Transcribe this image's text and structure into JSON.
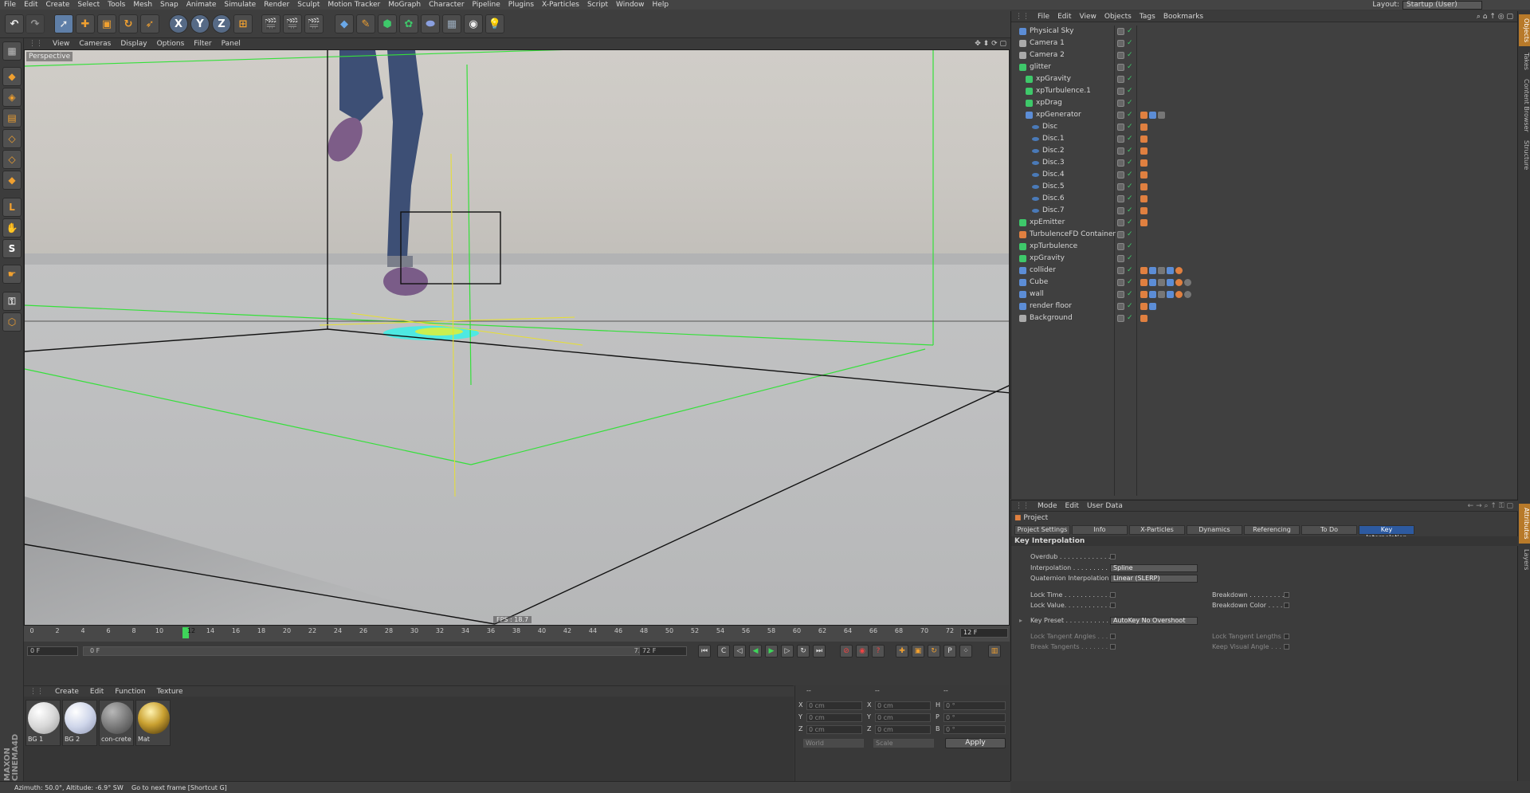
{
  "menubar": {
    "items": [
      "File",
      "Edit",
      "Create",
      "Select",
      "Tools",
      "Mesh",
      "Snap",
      "Animate",
      "Simulate",
      "Render",
      "Sculpt",
      "Motion Tracker",
      "MoGraph",
      "Character",
      "Pipeline",
      "Plugins",
      "X-Particles",
      "Script",
      "Window",
      "Help"
    ],
    "layout_label": "Layout:",
    "layout_value": "Startup (User)"
  },
  "toolbar": {
    "axis_x": "X",
    "axis_y": "Y",
    "axis_z": "Z"
  },
  "viewport": {
    "menu": [
      "View",
      "Cameras",
      "Display",
      "Options",
      "Filter",
      "Panel"
    ],
    "label": "Perspective",
    "fps": "FPS : 18.7"
  },
  "timeline": {
    "ticks": [
      "0",
      "2",
      "4",
      "6",
      "8",
      "10",
      "12",
      "14",
      "16",
      "18",
      "20",
      "22",
      "24",
      "26",
      "28",
      "30",
      "32",
      "34",
      "36",
      "38",
      "40",
      "42",
      "44",
      "46",
      "48",
      "50",
      "52",
      "54",
      "56",
      "58",
      "60",
      "62",
      "64",
      "66",
      "68",
      "70",
      "72"
    ],
    "current_frame": "12",
    "frame_box": "12 F",
    "start_field": "0 F",
    "range_start": "0 F",
    "range_end": "72 F",
    "end_field": "72 F"
  },
  "materials": {
    "menu": [
      "Create",
      "Edit",
      "Function",
      "Texture"
    ],
    "items": [
      {
        "name": "BG 1"
      },
      {
        "name": "BG 2"
      },
      {
        "name": "con-crete"
      },
      {
        "name": "Mat"
      }
    ]
  },
  "coords": {
    "header_a": "--",
    "header_b": "--",
    "header_c": "--",
    "pos_labels": [
      "X",
      "Y",
      "Z"
    ],
    "pos_values": [
      "0 cm",
      "0 cm",
      "0 cm"
    ],
    "size_labels": [
      "X",
      "Y",
      "Z"
    ],
    "size_values": [
      "0 cm",
      "0 cm",
      "0 cm"
    ],
    "rot_labels": [
      "H",
      "P",
      "B"
    ],
    "rot_values": [
      "0 °",
      "0 °",
      "0 °"
    ],
    "world": "World",
    "scale": "Scale",
    "apply": "Apply"
  },
  "status": {
    "left": "Azimuth: 50.0°, Altitude: -6.9° SW",
    "right": "Go to next frame [Shortcut G]"
  },
  "maxon": "MAXON CINEMA4D",
  "objects": {
    "menu": [
      "File",
      "Edit",
      "View",
      "Objects",
      "Tags",
      "Bookmarks"
    ],
    "rows": [
      {
        "name": "Physical Sky",
        "indent": 0
      },
      {
        "name": "Camera 1",
        "indent": 0
      },
      {
        "name": "Camera 2",
        "indent": 0
      },
      {
        "name": "glitter",
        "indent": 0
      },
      {
        "name": "xpGravity",
        "indent": 1
      },
      {
        "name": "xpTurbulence.1",
        "indent": 1
      },
      {
        "name": "xpDrag",
        "indent": 1
      },
      {
        "name": "xpGenerator",
        "indent": 1
      },
      {
        "name": "Disc",
        "indent": 2
      },
      {
        "name": "Disc.1",
        "indent": 2
      },
      {
        "name": "Disc.2",
        "indent": 2
      },
      {
        "name": "Disc.3",
        "indent": 2
      },
      {
        "name": "Disc.4",
        "indent": 2
      },
      {
        "name": "Disc.5",
        "indent": 2
      },
      {
        "name": "Disc.6",
        "indent": 2
      },
      {
        "name": "Disc.7",
        "indent": 2
      },
      {
        "name": "xpEmitter",
        "indent": 0
      },
      {
        "name": "TurbulenceFD Container",
        "indent": 0
      },
      {
        "name": "xpTurbulence",
        "indent": 0
      },
      {
        "name": "xpGravity",
        "indent": 0
      },
      {
        "name": "collider",
        "indent": 0
      },
      {
        "name": "Cube",
        "indent": 0
      },
      {
        "name": "wall",
        "indent": 0
      },
      {
        "name": "render floor",
        "indent": 0
      },
      {
        "name": "Background",
        "indent": 0
      }
    ]
  },
  "right_tabs": [
    "Objects",
    "Takes",
    "Content Browser",
    "Structure"
  ],
  "right_tabs2": [
    "Attributes",
    "Layers"
  ],
  "attributes": {
    "menu": [
      "Mode",
      "Edit",
      "User Data"
    ],
    "project": "Project",
    "tabs": [
      "Project Settings",
      "Info",
      "X-Particles",
      "Dynamics",
      "Referencing",
      "To Do",
      "Key Interpolation"
    ],
    "section": "Key Interpolation",
    "overdub": "Overdub . . . . . . . . . . . . .",
    "interpolation": "Interpolation . . . . . . . . .",
    "interpolation_value": "Spline",
    "quaternion": "Quaternion Interpolation",
    "quaternion_value": "Linear (SLERP)",
    "lock_time": "Lock Time . . . . . . . . . . . .",
    "lock_value": "Lock Value. . . . . . . . . . . .",
    "breakdown": "Breakdown . . . . . . . . . .",
    "breakdown_color": "Breakdown Color . . . . .",
    "key_preset": "Key Preset . . . . . . . . . . .",
    "key_preset_value": "AutoKey No Overshoot",
    "lock_tangent_angles": "Lock Tangent Angles . . .",
    "break_tangents": "Break Tangents . . . . . . . .",
    "lock_tangent_lengths": "Lock Tangent Lengths . .",
    "keep_visual_angle": "Keep Visual Angle . . . . ."
  }
}
